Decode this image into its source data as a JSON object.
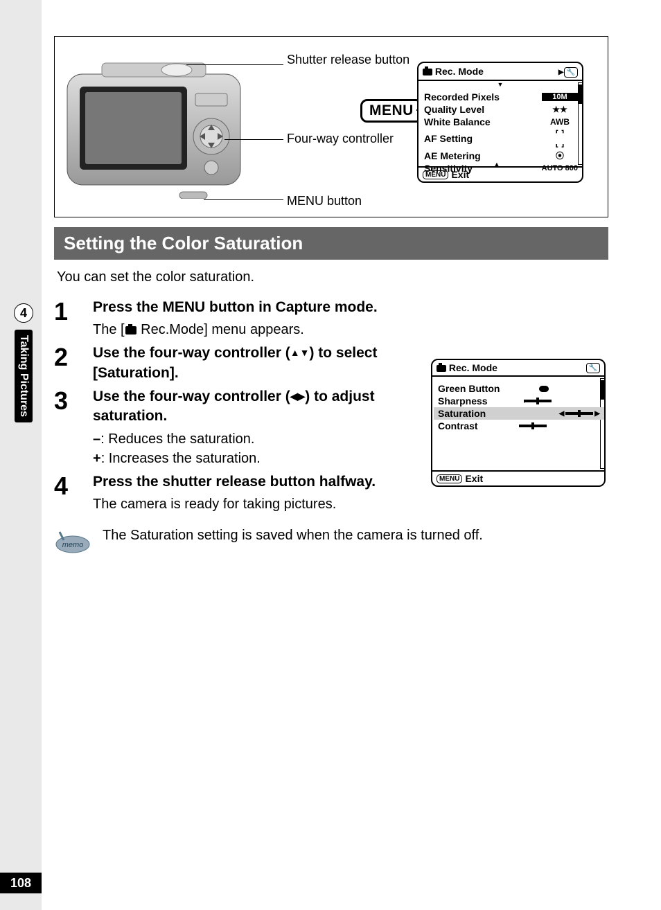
{
  "page": {
    "number": "108",
    "chapter": "4",
    "side_label": "Taking Pictures"
  },
  "diagram": {
    "label_shutter": "Shutter release button",
    "label_fourway": "Four-way controller",
    "label_menu_btn": "MENU button",
    "menu_badge": "MENU"
  },
  "screen_main": {
    "title": "Rec. Mode",
    "footer": "Exit",
    "rows": [
      {
        "label": "Recorded Pixels",
        "value": "10M"
      },
      {
        "label": "Quality Level",
        "value": "★★"
      },
      {
        "label": "White Balance",
        "value": "AWB"
      },
      {
        "label": "AF Setting",
        "value": "[ ]"
      },
      {
        "label": "AE Metering",
        "value": "◉"
      },
      {
        "label": "Sensitivity",
        "value": "AUTO 800"
      }
    ]
  },
  "screen_saturation": {
    "title": "Rec. Mode",
    "footer": "Exit",
    "rows": [
      {
        "label": "Green Button"
      },
      {
        "label": "Sharpness"
      },
      {
        "label": "Saturation",
        "selected": true
      },
      {
        "label": "Contrast"
      }
    ]
  },
  "section_title": "Setting the Color Saturation",
  "intro_text": "You can set the color saturation.",
  "steps": {
    "s1": {
      "num": "1",
      "head": "Press the MENU button in Capture mode.",
      "body_pre": "The [",
      "body_post": " Rec.Mode] menu appears."
    },
    "s2": {
      "num": "2",
      "head_pre": "Use the four-way controller (",
      "head_arrows": "▲▼",
      "head_post": ") to select [Saturation]."
    },
    "s3": {
      "num": "3",
      "head_pre": "Use the four-way controller (",
      "head_arrows": "◀▶",
      "head_post": ") to adjust saturation.",
      "minus": "–",
      "minus_text": ": Reduces the saturation.",
      "plus": "+",
      "plus_text": ": Increases the saturation."
    },
    "s4": {
      "num": "4",
      "head": "Press the shutter release button halfway.",
      "body": "The camera is ready for taking pictures."
    }
  },
  "memo": {
    "label": "memo",
    "text": "The Saturation setting is saved when the camera is turned off."
  }
}
